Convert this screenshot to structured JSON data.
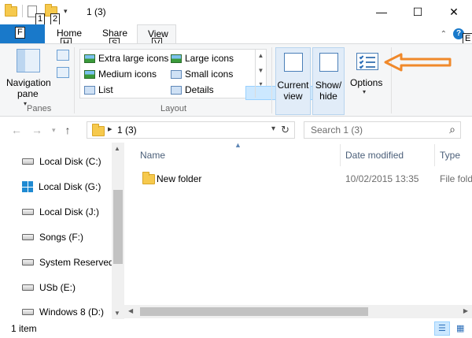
{
  "window": {
    "title": "1 (3)",
    "minimize": "—",
    "maximize": "☐",
    "close": "✕"
  },
  "keytips": {
    "qat_1": "1",
    "qat_2": "2",
    "file": "F",
    "home": "H",
    "share": "S",
    "view": "V",
    "help": "E"
  },
  "tabs": {
    "file": "File",
    "home": "Home",
    "share": "Share",
    "view": "View"
  },
  "ribbon": {
    "panes": {
      "navigation_pane_line1": "Navigation",
      "navigation_pane_line2": "pane",
      "group_label": "Panes"
    },
    "layout": {
      "group_label": "Layout",
      "items": {
        "extra_large_icons": "Extra large icons",
        "large_icons": "Large icons",
        "medium_icons": "Medium icons",
        "small_icons": "Small icons",
        "list": "List",
        "details": "Details"
      }
    },
    "current_view_line1": "Current",
    "current_view_line2": "view",
    "show_hide_line1": "Show/",
    "show_hide_line2": "hide",
    "options": "Options"
  },
  "address": {
    "path": "1 (3)",
    "search_placeholder": "Search 1 (3)"
  },
  "nav_pane": {
    "items": [
      {
        "label": "Local Disk (C:)",
        "icon": "drive-icon"
      },
      {
        "label": "Local Disk (G:)",
        "icon": "windows-drive-icon"
      },
      {
        "label": "Local Disk (J:)",
        "icon": "drive-icon"
      },
      {
        "label": "Songs (F:)",
        "icon": "drive-icon"
      },
      {
        "label": "System Reserved",
        "icon": "drive-icon"
      },
      {
        "label": "USb (E:)",
        "icon": "drive-icon"
      },
      {
        "label": "Windows 8 (D:)",
        "icon": "drive-icon"
      }
    ]
  },
  "file_list": {
    "columns": {
      "name": "Name",
      "date_modified": "Date modified",
      "type": "Type"
    },
    "rows": [
      {
        "name": "New folder",
        "date_modified": "10/02/2015 13:35",
        "type": "File fold"
      }
    ]
  },
  "status": {
    "item_count": "1 item"
  },
  "colors": {
    "accent": "#1979ca",
    "annotation_arrow": "#f0892b",
    "selection": "#cce8ff"
  }
}
